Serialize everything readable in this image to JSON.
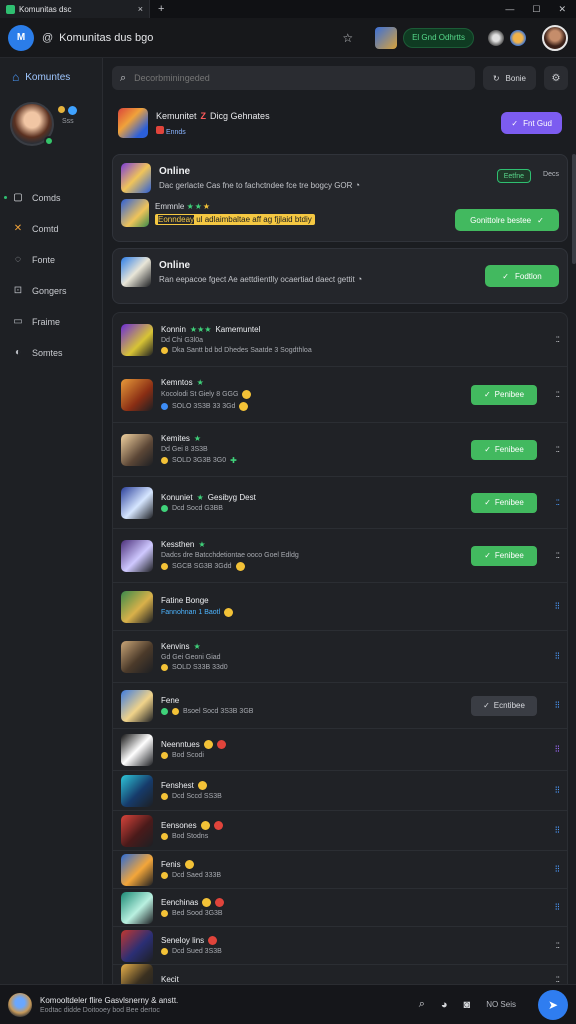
{
  "browser": {
    "tab_title": "Komunitas dsc",
    "tab_close": "×",
    "new_tab": "+",
    "minimize": "—",
    "maximize": "☐",
    "close": "✕"
  },
  "header": {
    "logo": "M",
    "address": "Komunitas dus bgo",
    "status_pill": "El Gnd Odhrtts"
  },
  "sidebar": {
    "brand": "Komuntes",
    "profile_sub": "Sss",
    "items": [
      {
        "label": "Comds",
        "icon": "message-icon"
      },
      {
        "label": "Comtd",
        "icon": "bolt-icon"
      },
      {
        "label": "Fonte",
        "icon": "chat-icon"
      },
      {
        "label": "Gongers",
        "icon": "gamepad-icon"
      },
      {
        "label": "Fraime",
        "icon": "monitor-icon"
      },
      {
        "label": "Somtes",
        "icon": "discord-icon"
      }
    ]
  },
  "search": {
    "placeholder": "Decorbminingeded",
    "filter_label": "Bonie"
  },
  "top_card": {
    "title_a": "Kemunitet",
    "title_z": "Z",
    "title_b": "Dicg Gehnates",
    "sub": "Ennds",
    "button": "Fnt Gud"
  },
  "panel_online_1": {
    "title": "Online",
    "desc": "Dac gerlacte Cas fne to fachctndee fce tre bogcy GOR",
    "status": "Eetfne",
    "status_side": "Decs",
    "sub_title": "Emmnle",
    "highlight_pre": "Eonndeay",
    "highlight": "ul adlaimbaltae aff ag fjjlaid btdiy",
    "button": "Gonittolre bestee"
  },
  "panel_online_2": {
    "title": "Online",
    "desc": "Ran eepacoe fgect Ae aettdientlly ocaertiad daect gettit",
    "button": "Fodtlon"
  },
  "rows": [
    {
      "name": "Konnin",
      "name2": "Kamemuntel",
      "line1": "Dd Chi G3l0a",
      "line2": "Dka Santt bd bd Dhedes Saatde 3 Sogdthloa",
      "button": "",
      "more": "::",
      "thumb": "linear-gradient(135deg,#6b2bd9,#d8c435 60%,#1d1f23)"
    },
    {
      "name": "Kemntos",
      "name2": "",
      "line1": "Kocolodi St Giely 8 GGG",
      "line2": "SOLO 3S3B 33 3Gd",
      "button": "Penibee",
      "more": "::",
      "thumb": "linear-gradient(135deg,#e89a3a,#8a2e14 60%,#1d1f23)"
    },
    {
      "name": "Kemites",
      "name2": "",
      "line1": "Dd Gei 8 3S3B",
      "line2": "SOLD 3G3B 3G0",
      "button": "Fenibee",
      "more": "::",
      "thumb": "linear-gradient(135deg,#f2d2a0,#5b4636 60%,#1d1f23)"
    },
    {
      "name": "Konuniet",
      "name2": "Gesibyg Dest",
      "line1": "",
      "line2": "Dcd Socd G3BB",
      "button": "Fenibee",
      "more": "::",
      "thumb": "linear-gradient(135deg,#2a3f9a,#d6e6ff 55%,#1d1f23)"
    },
    {
      "name": "Kessthen",
      "name2": "",
      "line1": "Dadcs dre Batcchdetiontae ooco Goel Edldg",
      "line2": "SGCB SG3B 3Gdd",
      "button": "Fenibee",
      "more": "::",
      "thumb": "linear-gradient(135deg,#4b2f7a,#cfc9ff 55%,#1d1f23)"
    },
    {
      "name": "Fatine Bonge",
      "name2": "",
      "line1": "",
      "line2": "Fannohnan 1 Baotl",
      "button": "",
      "more": "⁝⁝",
      "thumb": "linear-gradient(135deg,#3a8a4b,#d9b14a 55%,#1d1f23)"
    },
    {
      "name": "Kenvins",
      "name2": "",
      "line1": "Gd Gei Geoni Giad",
      "line2": "SOLD S33B 33d0",
      "button": "",
      "more": "⁝⁝",
      "thumb": "linear-gradient(135deg,#c9a577,#4b3a2a 55%,#1d1f23)"
    },
    {
      "name": "Fene",
      "name2": "",
      "line1": "",
      "line2": "Bsoel Socd 3S3B 3GB",
      "button": "Ecntibee",
      "more": "⁝⁝",
      "thumb": "linear-gradient(135deg,#3d7be0,#f0d38a 55%,#1d1f23)"
    },
    {
      "name": "Neenntues",
      "name2": "",
      "line1": "",
      "line2": "Bod Scodi",
      "button": "",
      "more": "⁝⁝",
      "thumb": "linear-gradient(135deg,#111,#ffffff 50%,#1d1f23)"
    },
    {
      "name": "Fenshest",
      "name2": "",
      "line1": "",
      "line2": "Dcd Sccd SS3B",
      "button": "",
      "more": "⁝⁝",
      "thumb": "linear-gradient(135deg,#2ec7d9,#163b6b 55%,#1d1f23)"
    },
    {
      "name": "Eensones",
      "name2": "",
      "line1": "",
      "line2": "Bod Stodns",
      "button": "",
      "more": "⁝⁝",
      "thumb": "linear-gradient(135deg,#d9443b,#4a1a1a 55%,#1d1f23)"
    },
    {
      "name": "Fenis",
      "name2": "",
      "line1": "",
      "line2": "Dcd Saed 333B",
      "button": "",
      "more": "⁝⁝",
      "thumb": "linear-gradient(135deg,#2a6bd8,#f3a63a 55%,#1d1f23)"
    },
    {
      "name": "Eenchinas",
      "name2": "",
      "line1": "",
      "line2": "Bed Sood 3G3B",
      "button": "",
      "more": "⁝⁝",
      "thumb": "linear-gradient(135deg,#1a8a74,#b9f0e0 55%,#1d1f23)"
    },
    {
      "name": "Seneloy lins",
      "name2": "",
      "line1": "",
      "line2": "Dcd Sued 3S3B",
      "button": "",
      "more": "::",
      "thumb": "linear-gradient(135deg,#c2372f,#2b2f75 55%,#1d1f23)"
    },
    {
      "name": "Kecit",
      "name2": "",
      "line1": "",
      "line2": "",
      "button": "",
      "more": "::",
      "thumb": "linear-gradient(135deg,#e8b04a,#3a3020 55%,#1d1f23)"
    }
  ],
  "bottom": {
    "title": "Komooltdeler flire Gasvlsnerny & anstt.",
    "sub": "Eodtac didde Doitooey bod Bee dertoc",
    "label": "NO Seis"
  },
  "colors": {
    "accent_green": "#42b95f",
    "accent_purple": "#7c5cf0",
    "accent_blue": "#2f7df0",
    "background": "#1b1d21"
  }
}
